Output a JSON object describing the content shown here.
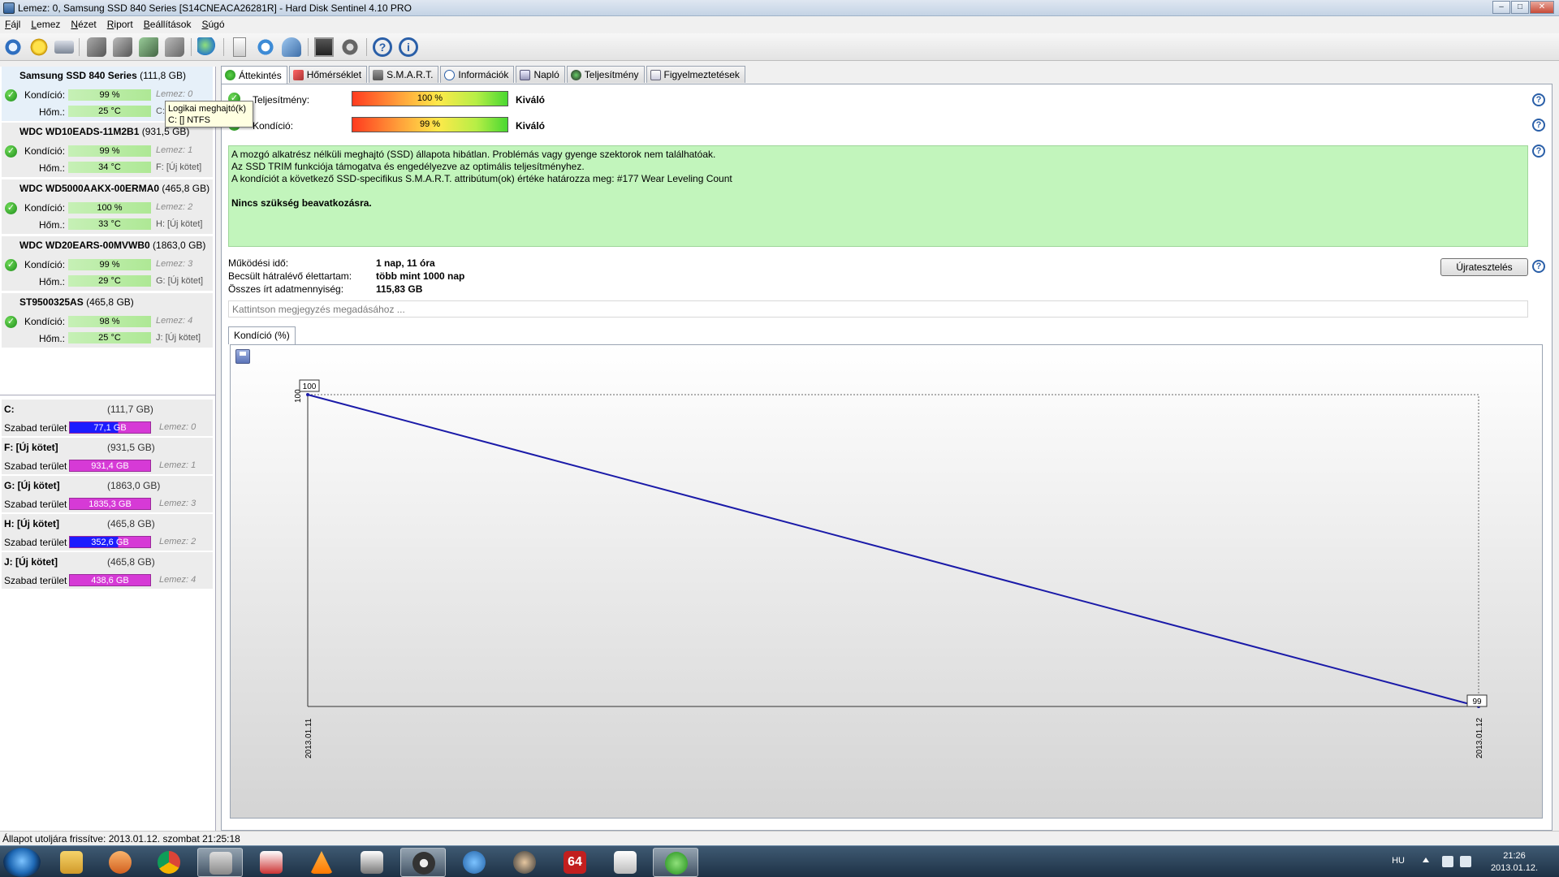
{
  "window": {
    "title": "Lemez: 0, Samsung SSD 840 Series [S14CNEACA26281R]  -  Hard Disk Sentinel 4.10 PRO",
    "minimize": "–",
    "maximize": "□",
    "close": "✕"
  },
  "menu": [
    "Fájl",
    "Lemez",
    "Nézet",
    "Riport",
    "Beállítások",
    "Súgó"
  ],
  "toolbar_icons": [
    "refresh-icon",
    "alert-icon",
    "disk-icon",
    "tool1-icon",
    "tool2-icon",
    "tool3-icon",
    "tool4-icon",
    "globe-icon",
    "report-icon",
    "sync-icon",
    "network-icon",
    "monitor-icon",
    "settings-icon",
    "help-icon",
    "info-icon"
  ],
  "disks": [
    {
      "name": "Samsung SSD 840 Series",
      "size": "(111,8 GB)",
      "condition_label": "Kondíció:",
      "condition": "99 %",
      "temp_label": "Hőm.:",
      "temp": "25 °C",
      "disk_no": "Lemez: 0",
      "volume": "C:"
    },
    {
      "name": "WDC WD10EADS-11M2B1",
      "size": "(931,5 GB)",
      "condition_label": "Kondíció:",
      "condition": "99 %",
      "temp_label": "Hőm.:",
      "temp": "34 °C",
      "disk_no": "Lemez: 1",
      "volume": "F: [Új kötet]"
    },
    {
      "name": "WDC WD5000AAKX-00ERMA0",
      "size": "(465,8 GB)",
      "condition_label": "Kondíció:",
      "condition": "100 %",
      "temp_label": "Hőm.:",
      "temp": "33 °C",
      "disk_no": "Lemez: 2",
      "volume": "H: [Új kötet]"
    },
    {
      "name": "WDC WD20EARS-00MVWB0",
      "size": "(1863,0 GB)",
      "condition_label": "Kondíció:",
      "condition": "99 %",
      "temp_label": "Hőm.:",
      "temp": "29 °C",
      "disk_no": "Lemez: 3",
      "volume": "G: [Új kötet]"
    },
    {
      "name": "ST9500325AS",
      "size": "(465,8 GB)",
      "condition_label": "Kondíció:",
      "condition": "98 %",
      "temp_label": "Hőm.:",
      "temp": "25 °C",
      "disk_no": "Lemez: 4",
      "volume": "J: [Új kötet]"
    }
  ],
  "volumes": [
    {
      "name": "C:",
      "size": "(111,7 GB)",
      "free_label": "Szabad terület",
      "free": "77,1 GB",
      "disk_no": "Lemez: 0",
      "color": "blue"
    },
    {
      "name": "F: [Új kötet]",
      "size": "(931,5 GB)",
      "free_label": "Szabad terület",
      "free": "931,4 GB",
      "disk_no": "Lemez: 1",
      "color": "magenta"
    },
    {
      "name": "G: [Új kötet]",
      "size": "(1863,0 GB)",
      "free_label": "Szabad terület",
      "free": "1835,3 GB",
      "disk_no": "Lemez: 3",
      "color": "magenta"
    },
    {
      "name": "H: [Új kötet]",
      "size": "(465,8 GB)",
      "free_label": "Szabad terület",
      "free": "352,6 GB",
      "disk_no": "Lemez: 2",
      "color": "blue"
    },
    {
      "name": "J: [Új kötet]",
      "size": "(465,8 GB)",
      "free_label": "Szabad terület",
      "free": "438,6 GB",
      "disk_no": "Lemez: 4",
      "color": "magenta"
    }
  ],
  "tooltip": {
    "line1": "Logikai meghajtó(k)",
    "line2": "C: [] NTFS"
  },
  "tabs": [
    "Áttekintés",
    "Hőmérséklet",
    "S.M.A.R.T.",
    "Információk",
    "Napló",
    "Teljesítmény",
    "Figyelmeztetések"
  ],
  "overview": {
    "performance_label": "Teljesítmény:",
    "performance_value": "100 %",
    "performance_text": "Kiváló",
    "condition_label": "Kondíció:",
    "condition_value": "99 %",
    "condition_text": "Kiváló",
    "message_lines": [
      "A mozgó alkatrész nélküli meghajtó (SSD) állapota hibátlan. Problémás vagy gyenge szektorok nem találhatóak.",
      "Az SSD TRIM funkciója támogatva és engedélyezve az optimális teljesítményhez.",
      "A kondíciót a következő SSD-specifikus S.M.A.R.T. attribútum(ok) értéke határozza meg:  #177 Wear Leveling Count"
    ],
    "message_bold": "Nincs szükség beavatkozásra.",
    "uptime_label": "Működési idő:",
    "uptime_value": "1 nap, 11 óra",
    "lifetime_label": "Becsült hátralévő élettartam:",
    "lifetime_value": "több mint 1000 nap",
    "written_label": "Összes írt adatmennyiség:",
    "written_value": "115,83 GB",
    "retest_button": "Újratesztelés",
    "note_placeholder": "Kattintson megjegyzés megadásához ...",
    "chart_tab": "Kondíció  (%)"
  },
  "chart_data": {
    "type": "line",
    "x": [
      "2013.01.11",
      "2013.01.12"
    ],
    "series": [
      {
        "values": [
          100,
          99
        ]
      }
    ],
    "point_labels": [
      "100",
      "99"
    ],
    "ylabel": "100",
    "ylim": [
      99,
      100
    ],
    "grid": false,
    "line_color": "#1a1aa8"
  },
  "status": "Állapot utoljára frissítve: 2013.01.12. szombat 21:25:18",
  "taskbar": {
    "apps": [
      "explorer-icon",
      "media-icon",
      "chrome-icon",
      "hdsentinel-icon",
      "notes-icon",
      "vlc-icon",
      "movie-icon",
      "steam-icon",
      "flash-icon",
      "avatar-icon",
      "aida64-icon",
      "tool-icon",
      "utorrent-icon"
    ],
    "lang": "HU",
    "time": "21:26",
    "date": "2013.01.12."
  }
}
